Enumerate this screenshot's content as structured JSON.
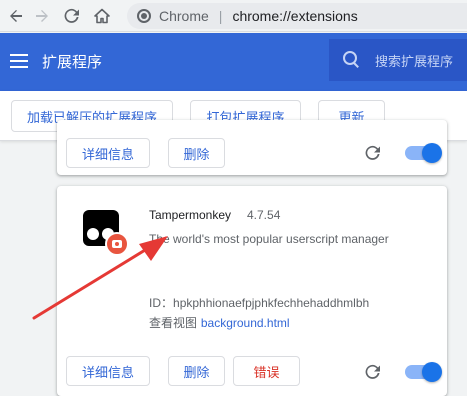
{
  "browser": {
    "back_icon": "arrow-left-icon",
    "forward_icon": "arrow-right-icon",
    "reload_icon": "reload-icon",
    "home_icon": "home-icon",
    "site_label": "Chrome",
    "separator": "|",
    "url": "chrome://extensions"
  },
  "header": {
    "title": "扩展程序",
    "search_placeholder": "搜索扩展程序"
  },
  "toolbar": {
    "load_unpacked": "加载已解压的扩展程序",
    "pack_extension": "打包扩展程序",
    "update": "更新"
  },
  "cards": [
    {
      "details_label": "详细信息",
      "remove_label": "删除",
      "enabled": true
    },
    {
      "name": "Tampermonkey",
      "version": "4.7.54",
      "description": "The world's most popular userscript manager",
      "id_label": "ID：",
      "id_value": "hpkphhionaefpjphkfechhehaddhmlbh",
      "inspect_label": "查看视图",
      "inspect_link": "background.html",
      "details_label": "详细信息",
      "remove_label": "删除",
      "errors_label": "错误",
      "enabled": true
    }
  ],
  "colors": {
    "header_blue": "#3367d6",
    "accent_blue": "#1a73e8",
    "error_red": "#d93025",
    "annotation_arrow": "#e53935"
  }
}
